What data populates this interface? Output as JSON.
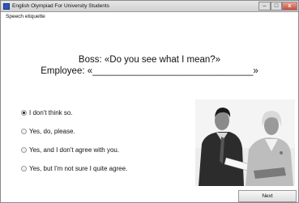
{
  "window": {
    "title": "English Olympiad For University Students",
    "minimize": "‒",
    "maximize": "□",
    "close": "x"
  },
  "section_label": "Speech etiquette",
  "question": {
    "line1": "Boss: «Do you see what I mean?»",
    "line2": "Employee: «_______________________________»"
  },
  "options": [
    {
      "label": "I don't think so.",
      "selected": true
    },
    {
      "label": "Yes, do, please.",
      "selected": false
    },
    {
      "label": "Yes, and I don't agree with you.",
      "selected": false
    },
    {
      "label": "Yes, but I'm not sure I quite agree.",
      "selected": false
    }
  ],
  "next_label": "Next",
  "illustration": "business-meeting-photo"
}
